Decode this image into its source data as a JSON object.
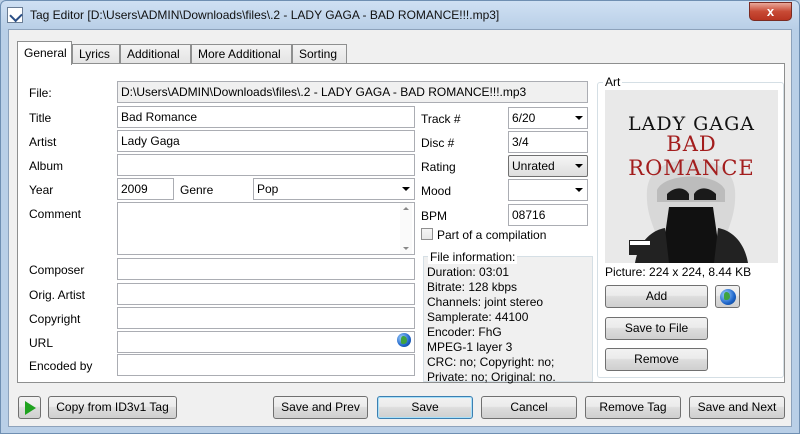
{
  "window": {
    "title": "Tag Editor [D:\\Users\\ADMIN\\Downloads\\files\\.2 - LADY GAGA - BAD ROMANCE!!!.mp3]",
    "close_label": "x"
  },
  "tabs": [
    "General",
    "Lyrics",
    "Additional",
    "More Additional",
    "Sorting"
  ],
  "general": {
    "file_label": "File:",
    "file_value": "D:\\Users\\ADMIN\\Downloads\\files\\.2 - LADY GAGA - BAD ROMANCE!!!.mp3",
    "title_label": "Title",
    "title_value": "Bad Romance",
    "artist_label": "Artist",
    "artist_value": "Lady Gaga",
    "album_label": "Album",
    "album_value": "",
    "year_label": "Year",
    "year_value": "2009",
    "genre_label": "Genre",
    "genre_value": "Pop",
    "comment_label": "Comment",
    "comment_value": "",
    "composer_label": "Composer",
    "composer_value": "",
    "orig_artist_label": "Orig. Artist",
    "orig_artist_value": "",
    "copyright_label": "Copyright",
    "copyright_value": "",
    "url_label": "URL",
    "url_value": "",
    "encoded_by_label": "Encoded by",
    "encoded_by_value": "",
    "track_label": "Track #",
    "track_value": "6/20",
    "disc_label": "Disc #",
    "disc_value": "3/4",
    "rating_label": "Rating",
    "rating_value": "Unrated",
    "mood_label": "Mood",
    "mood_value": "",
    "bpm_label": "BPM",
    "bpm_value": "08716",
    "compilation_label": "Part of a compilation"
  },
  "file_info": {
    "title": "File information:",
    "lines": [
      "Duration: 03:01",
      "Bitrate: 128 kbps",
      "Channels: joint stereo",
      "Samplerate: 44100",
      "Encoder: FhG",
      "MPEG-1 layer 3",
      "CRC: no; Copyright: no;",
      "Private: no; Original: no."
    ]
  },
  "art": {
    "title": "Art",
    "image_line1": "LADY GAGA",
    "image_line2": "BAD ROMANCE",
    "picture_info": "Picture: 224 x 224, 8.44 KB",
    "add_label": "Add",
    "save_to_file_label": "Save to File",
    "remove_label": "Remove"
  },
  "footer": {
    "copy_label": "Copy from ID3v1 Tag",
    "save_prev_label": "Save and Prev",
    "save_label": "Save",
    "cancel_label": "Cancel",
    "remove_tag_label": "Remove Tag",
    "save_next_label": "Save and Next"
  }
}
